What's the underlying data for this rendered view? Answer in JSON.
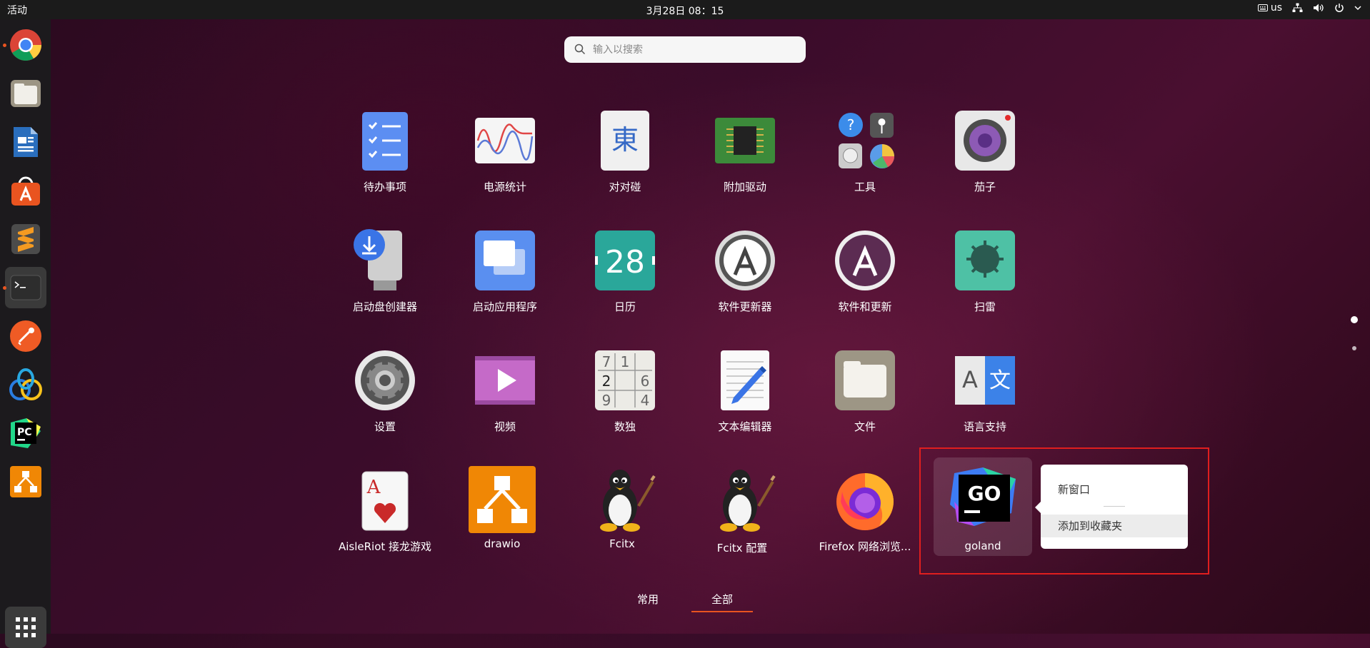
{
  "topbar": {
    "activities": "活动",
    "clock": "3月28日  08：15",
    "keyboard_layout": "us",
    "icons": [
      "keyboard-icon",
      "network-icon",
      "volume-icon",
      "power-icon",
      "chevron-down-icon"
    ]
  },
  "dock": {
    "items": [
      {
        "name": "google-chrome",
        "running": true
      },
      {
        "name": "files"
      },
      {
        "name": "libreoffice-writer"
      },
      {
        "name": "ubuntu-software"
      },
      {
        "name": "sublime-text"
      },
      {
        "name": "terminal",
        "running": true,
        "active": true
      },
      {
        "name": "postman"
      },
      {
        "name": "navicat"
      },
      {
        "name": "pycharm"
      },
      {
        "name": "drawio"
      }
    ],
    "show_apps": "show-applications"
  },
  "search": {
    "placeholder": "输入以搜索"
  },
  "apps": [
    {
      "label": "待办事项"
    },
    {
      "label": "电源统计"
    },
    {
      "label": "对对碰",
      "glyph": "東"
    },
    {
      "label": "附加驱动"
    },
    {
      "label": "工具"
    },
    {
      "label": "茄子"
    },
    {
      "label": "启动盘创建器"
    },
    {
      "label": "启动应用程序"
    },
    {
      "label": "日历",
      "glyph": "28"
    },
    {
      "label": "软件更新器"
    },
    {
      "label": "软件和更新"
    },
    {
      "label": "扫雷"
    },
    {
      "label": "设置"
    },
    {
      "label": "视频"
    },
    {
      "label": "数独",
      "cells": [
        "7",
        "1",
        "",
        "2",
        "",
        "6",
        "9",
        "",
        "4"
      ]
    },
    {
      "label": "文本编辑器"
    },
    {
      "label": "文件"
    },
    {
      "label": "语言支持",
      "glyph_a": "A",
      "glyph_b": "文"
    },
    {
      "label": "AisleRiot 接龙游戏",
      "glyph": "A"
    },
    {
      "label": "drawio"
    },
    {
      "label": "Fcitx"
    },
    {
      "label": "Fcitx 配置"
    },
    {
      "label": "Firefox 网络浏览..."
    },
    {
      "label": "goland",
      "glyph": "GO"
    }
  ],
  "context_menu": {
    "items": [
      "新窗口",
      "添加到收藏夹"
    ],
    "hovered_index": 1
  },
  "tabs": {
    "frequent": "常用",
    "all": "全部",
    "selected": "全部"
  },
  "pages": {
    "count": 2,
    "current": 1
  },
  "colors": {
    "accent": "#e95420",
    "highlight_box": "#e01e1e"
  }
}
